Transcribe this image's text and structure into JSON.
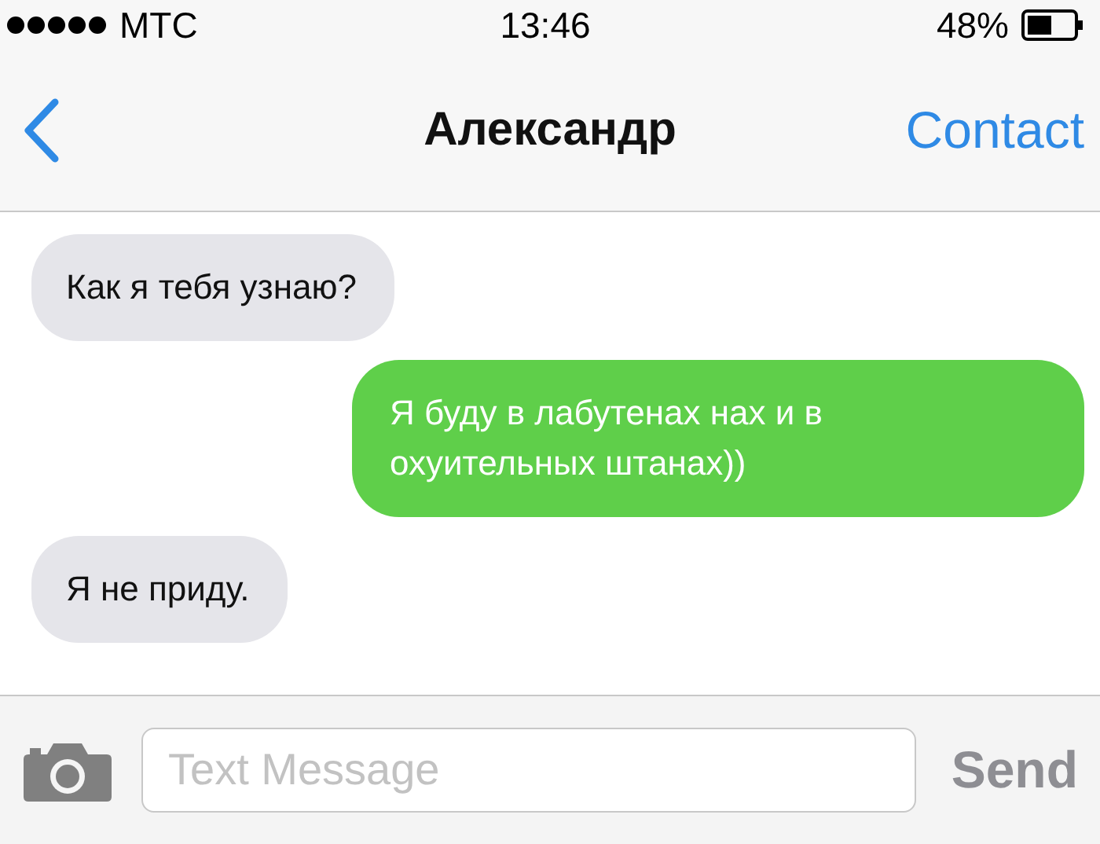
{
  "status_bar": {
    "carrier": "МТС",
    "time": "13:46",
    "battery": "48%"
  },
  "nav": {
    "title": "Александр",
    "right_button": "Contact"
  },
  "messages": [
    {
      "kind": "received",
      "text": "Как я тебя узнаю?"
    },
    {
      "kind": "sent",
      "text": "Я буду в лабутенах нах и в охуительных штанах))"
    },
    {
      "kind": "received",
      "text": "Я не приду."
    }
  ],
  "composer": {
    "placeholder": "Text Message",
    "send_label": "Send"
  }
}
